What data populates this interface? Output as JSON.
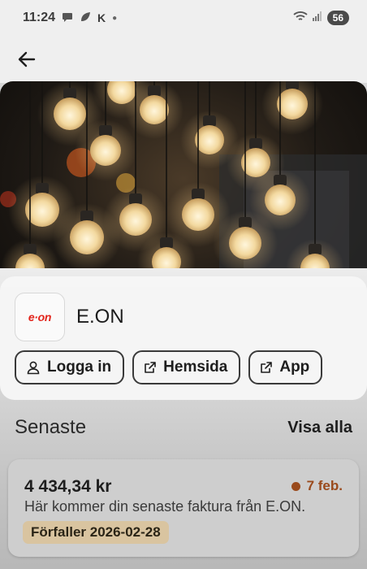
{
  "status_bar": {
    "time": "11:24",
    "carrier_letter": "K",
    "battery": "56"
  },
  "header": {
    "back_icon": "arrow-left-icon"
  },
  "provider": {
    "logo_text": "e·on",
    "name": "E.ON",
    "brand_color": "#e2231a"
  },
  "actions": [
    {
      "label": "Logga in",
      "icon": "user-icon"
    },
    {
      "label": "Hemsida",
      "icon": "external-link-icon"
    },
    {
      "label": "App",
      "icon": "external-link-icon"
    }
  ],
  "recent": {
    "title": "Senaste",
    "see_all": "Visa alla"
  },
  "invoice": {
    "amount": "4 434,34 kr",
    "date": "7 feb.",
    "date_color": "#9a4a1c",
    "description": "Här kommer din senaste faktura från E.ON.",
    "due_label": "Förfaller 2026-02-28",
    "due_badge_color": "#d9c4a0"
  }
}
